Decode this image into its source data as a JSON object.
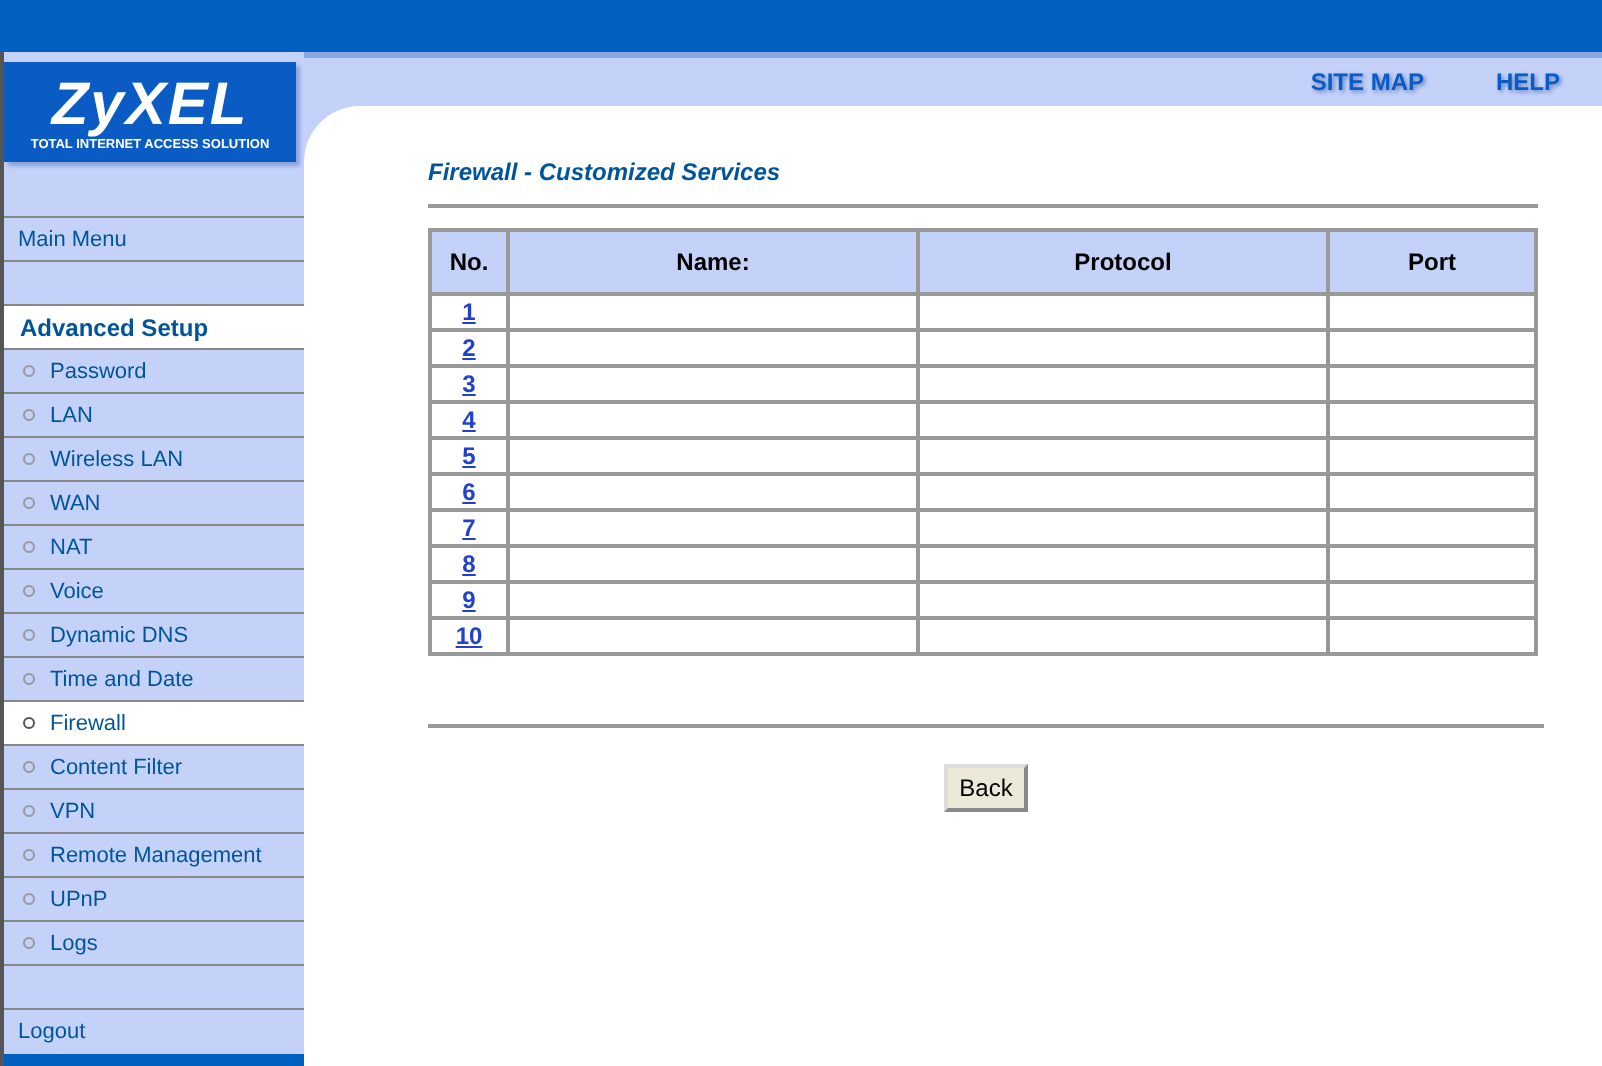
{
  "logo": {
    "name": "ZyXEL",
    "tagline": "TOTAL INTERNET ACCESS SOLUTION"
  },
  "header_links": [
    "SITE MAP",
    "HELP"
  ],
  "sidebar": {
    "main_menu": "Main Menu",
    "section": {
      "label": "Advanced Setup",
      "selected": true
    },
    "items": [
      {
        "label": "Password",
        "selected": false
      },
      {
        "label": "LAN",
        "selected": false
      },
      {
        "label": "Wireless LAN",
        "selected": false
      },
      {
        "label": "WAN",
        "selected": false
      },
      {
        "label": "NAT",
        "selected": false
      },
      {
        "label": "Voice",
        "selected": false
      },
      {
        "label": "Dynamic DNS",
        "selected": false
      },
      {
        "label": "Time and Date",
        "selected": false
      },
      {
        "label": "Firewall",
        "selected": true
      },
      {
        "label": "Content Filter",
        "selected": false
      },
      {
        "label": "VPN",
        "selected": false
      },
      {
        "label": "Remote Management",
        "selected": false
      },
      {
        "label": "UPnP",
        "selected": false
      },
      {
        "label": "Logs",
        "selected": false
      }
    ],
    "logout": "Logout"
  },
  "page_title": "Firewall - Customized Services",
  "table": {
    "columns": [
      "No.",
      "Name:",
      "Protocol",
      "Port"
    ],
    "rows": [
      {
        "no": "1"
      },
      {
        "no": "2"
      },
      {
        "no": "3"
      },
      {
        "no": "4"
      },
      {
        "no": "5"
      },
      {
        "no": "6"
      },
      {
        "no": "7"
      },
      {
        "no": "8"
      },
      {
        "no": "9"
      },
      {
        "no": "10"
      }
    ]
  },
  "buttons": [
    "Back"
  ]
}
